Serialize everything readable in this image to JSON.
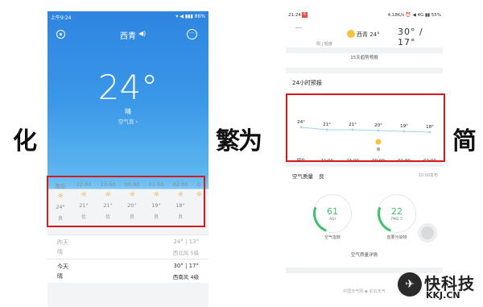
{
  "calligraphy": {
    "left": "化",
    "middle": "繁为",
    "right": "简"
  },
  "left_phone": {
    "status_time": "上午9:24",
    "status_right": "▾ ◀ ▮▮▮ 86%",
    "city": "西青",
    "temperature": "24°",
    "condition": "晴",
    "air_quality": "空气良 ›",
    "hourly": [
      {
        "time": "现在",
        "icon": "sun-icon",
        "temp": "24°",
        "aq": "良"
      },
      {
        "time": "22:00",
        "icon": "sun-icon",
        "temp": "21°",
        "aq": "优"
      },
      {
        "time": "23:00",
        "icon": "sun-icon",
        "temp": "21°",
        "aq": "优"
      },
      {
        "time": "00:00",
        "icon": "sun-icon",
        "temp": "20°",
        "aq": "良"
      },
      {
        "time": "01:00",
        "icon": "sun-icon",
        "temp": "19°",
        "aq": "良"
      },
      {
        "time": "02:00",
        "icon": "sun-icon",
        "temp": "18°",
        "aq": "良"
      },
      {
        "time": "0",
        "icon": "sun-icon",
        "temp": "",
        "aq": ""
      }
    ],
    "days": [
      {
        "name": "昨天",
        "condition": "晴",
        "temps": "24° | 13°",
        "wind": "西北风 5级"
      },
      {
        "name": "今天",
        "condition": "晴",
        "temps": "30° | 17°",
        "wind": "西南风 4级"
      }
    ]
  },
  "right_phone": {
    "status_time": "21:24",
    "status_badge": "6",
    "status_right": "4.18K/s ⏰ ◀ 4G ▮▮ 55%",
    "city": "西青 24°",
    "day_label": "阴 | 轻度",
    "hi_lo": "30° / 17°",
    "forecast_link": "15天趋势预报",
    "h24_title": "24小时预报",
    "weather_label": "晴",
    "aq_title": "空气质量",
    "aq_title_value": "良",
    "aq_time": "20:00发布",
    "gauge1": {
      "value": "61",
      "sub": "AQI",
      "label": "空气指数"
    },
    "gauge2": {
      "value": "22",
      "sub": "PM2.5",
      "label": "首要污染物"
    },
    "aq_detail": "空气质量详情",
    "footer": "中国天气网   ◉ 彩云天气"
  },
  "chart_data": {
    "type": "line",
    "title": "24小时预报",
    "categories": [
      "现在",
      "22:00",
      "23:00",
      "00:00",
      "01:00",
      "02:00"
    ],
    "series": [
      {
        "values": [
          24,
          21,
          21,
          20,
          19,
          18
        ]
      }
    ],
    "data_labels": [
      "24°",
      "21°",
      "21°",
      "20°",
      "19°",
      "18°"
    ],
    "annotations": [
      {
        "at": "00:00",
        "text": "晴",
        "icon": "sun-icon"
      }
    ],
    "grid": false,
    "legend": "none"
  },
  "watermark": {
    "cn": "快科技",
    "en": "KKJ.CN"
  },
  "colors": {
    "highlight": "#d6191c",
    "line": "#9fd3ec",
    "sun": "#e9a12a",
    "aq_good": "#3cc36b",
    "sky_top": "#2f85e0"
  }
}
